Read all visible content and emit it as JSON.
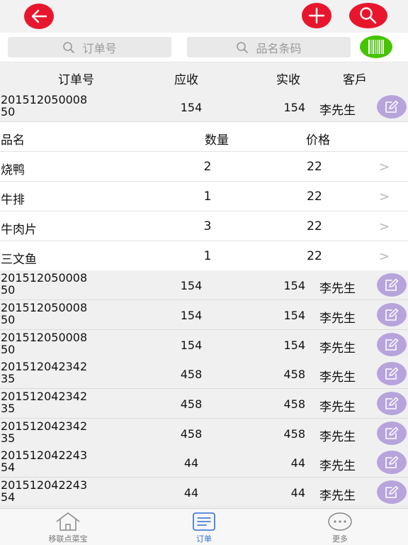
{
  "topbar": {
    "back_icon": "arrow-left-icon",
    "add_icon": "plus-icon",
    "search_icon": "magnifier-icon",
    "accent_color": "#e8162c"
  },
  "search": {
    "order_placeholder": "订单号",
    "product_placeholder": "品名条码",
    "barcode_icon": "barcode-icon"
  },
  "table_header": {
    "order_no": "订单号",
    "due": "应收",
    "paid": "实收",
    "customer": "客戶"
  },
  "expanded_order": {
    "order_no": "201512050008\n50",
    "due": "154",
    "paid": "154",
    "customer": "李先生"
  },
  "detail_header": {
    "name": "品名",
    "qty": "数量",
    "price": "价格"
  },
  "detail_items": [
    {
      "name": "烧鸭",
      "qty": "2",
      "price": "22"
    },
    {
      "name": "牛排",
      "qty": "1",
      "price": "22"
    },
    {
      "name": "牛肉片",
      "qty": "3",
      "price": "22"
    },
    {
      "name": "三文鱼",
      "qty": "1",
      "price": "22"
    }
  ],
  "orders": [
    {
      "order_no": "201512050008\n50",
      "due": "154",
      "paid": "154",
      "customer": "李先生"
    },
    {
      "order_no": "201512050008\n50",
      "due": "154",
      "paid": "154",
      "customer": "李先生"
    },
    {
      "order_no": "201512050008\n50",
      "due": "154",
      "paid": "154",
      "customer": "李先生"
    },
    {
      "order_no": "201512042342\n35",
      "due": "458",
      "paid": "458",
      "customer": "李先生"
    },
    {
      "order_no": "201512042342\n35",
      "due": "458",
      "paid": "458",
      "customer": "李先生"
    },
    {
      "order_no": "201512042342\n35",
      "due": "458",
      "paid": "458",
      "customer": "李先生"
    },
    {
      "order_no": "201512042243\n54",
      "due": "44",
      "paid": "44",
      "customer": "李先生"
    },
    {
      "order_no": "201512042243\n54",
      "due": "44",
      "paid": "44",
      "customer": "李先生"
    }
  ],
  "tabbar": {
    "home": "移联点菜宝",
    "orders": "订单",
    "more": "更多",
    "active_tab": "orders"
  }
}
